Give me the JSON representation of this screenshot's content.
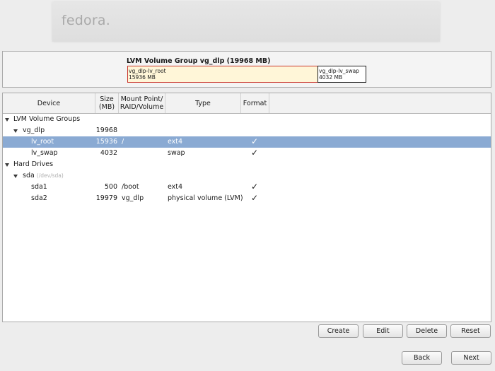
{
  "header": {
    "logo_text": "fedora."
  },
  "vg": {
    "title": "LVM Volume Group vg_dlp (19968 MB)",
    "segments": [
      {
        "name": "vg_dlp-lv_root",
        "size": "15936 MB"
      },
      {
        "name": "vg_dlp-lv_swap",
        "size": "4032 MB"
      }
    ]
  },
  "table": {
    "headers": {
      "device": "Device",
      "size": "Size\n(MB)",
      "mount": "Mount Point/\nRAID/Volume",
      "type": "Type",
      "format": "Format"
    },
    "rows": [
      {
        "device": "LVM Volume Groups",
        "size": "",
        "mount": "",
        "type": "",
        "format": false
      },
      {
        "device": "vg_dlp",
        "size": "19968",
        "mount": "",
        "type": "",
        "format": false
      },
      {
        "device": "lv_root",
        "size": "15936",
        "mount": "/",
        "type": "ext4",
        "format": true,
        "selected": true
      },
      {
        "device": "lv_swap",
        "size": "4032",
        "mount": "",
        "type": "swap",
        "format": true
      },
      {
        "device": "Hard Drives",
        "size": "",
        "mount": "",
        "type": "",
        "format": false
      },
      {
        "device": "sda",
        "sub": "(/dev/sda)",
        "size": "",
        "mount": "",
        "type": "",
        "format": false
      },
      {
        "device": "sda1",
        "size": "500",
        "mount": "/boot",
        "type": "ext4",
        "format": true
      },
      {
        "device": "sda2",
        "size": "19979",
        "mount": "vg_dlp",
        "type": "physical volume (LVM)",
        "format": true
      }
    ],
    "check_glyph": "✓"
  },
  "actions": {
    "create": "Create",
    "edit": "Edit",
    "delete": "Delete",
    "reset": "Reset"
  },
  "nav": {
    "back": "Back",
    "next": "Next"
  }
}
